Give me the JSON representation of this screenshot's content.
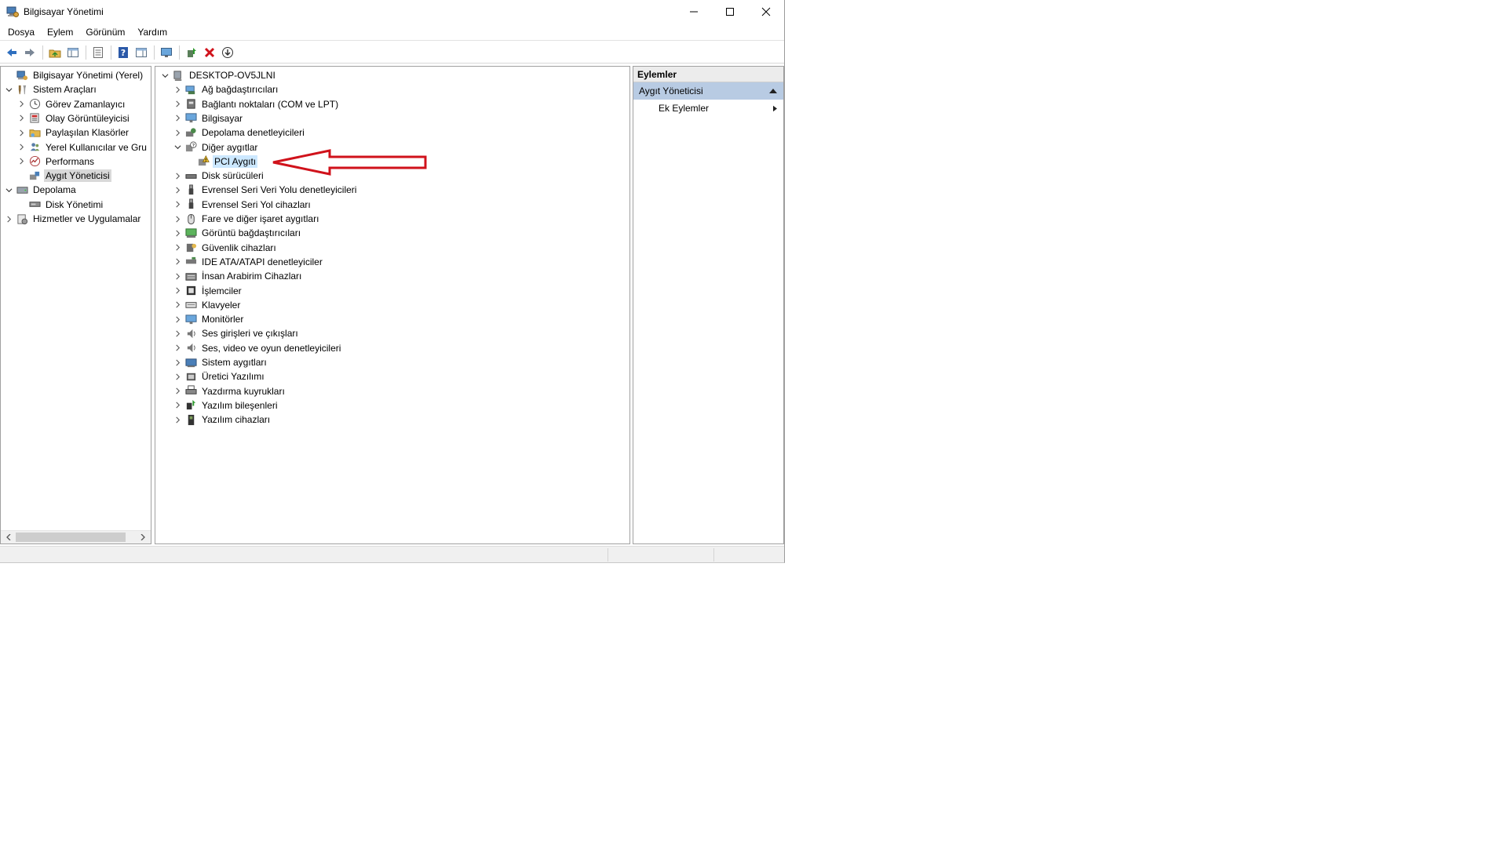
{
  "window": {
    "title": "Bilgisayar Yönetimi",
    "icon": "computer-management-icon"
  },
  "menu": [
    "Dosya",
    "Eylem",
    "Görünüm",
    "Yardım"
  ],
  "toolbar": {
    "icons": [
      "back-arrow-icon",
      "forward-arrow-icon",
      "up-folder-icon",
      "show-hide-tree-icon",
      "properties-icon",
      "help-icon",
      "show-hide-action-pane-icon",
      "monitor-icon",
      "update-driver-icon",
      "uninstall-x-icon",
      "scan-hardware-icon"
    ]
  },
  "left_tree": [
    {
      "label": "Bilgisayar Yönetimi (Yerel)",
      "level": 0,
      "expander": "none",
      "icon": "computer-management-icon"
    },
    {
      "label": "Sistem Araçları",
      "level": 0,
      "expander": "open",
      "icon": "tools-icon"
    },
    {
      "label": "Görev Zamanlayıcı",
      "level": 1,
      "expander": "closed",
      "icon": "clock-icon"
    },
    {
      "label": "Olay Görüntüleyicisi",
      "level": 1,
      "expander": "closed",
      "icon": "event-log-icon"
    },
    {
      "label": "Paylaşılan Klasörler",
      "level": 1,
      "expander": "closed",
      "icon": "shared-folder-icon"
    },
    {
      "label": "Yerel Kullanıcılar ve Gru",
      "level": 1,
      "expander": "closed",
      "icon": "users-icon"
    },
    {
      "label": "Performans",
      "level": 1,
      "expander": "closed",
      "icon": "performance-icon"
    },
    {
      "label": "Aygıt Yöneticisi",
      "level": 1,
      "expander": "none",
      "icon": "device-manager-icon",
      "selected": true
    },
    {
      "label": "Depolama",
      "level": 0,
      "expander": "open",
      "icon": "storage-icon"
    },
    {
      "label": "Disk Yönetimi",
      "level": 1,
      "expander": "none",
      "icon": "disk-management-icon"
    },
    {
      "label": "Hizmetler ve Uygulamalar",
      "level": 0,
      "expander": "closed",
      "icon": "services-icon"
    }
  ],
  "device_tree": {
    "root": {
      "label": "DESKTOP-OV5JLNI",
      "icon": "computer-icon"
    },
    "categories": [
      {
        "label": "Ağ bağdaştırıcıları",
        "icon": "network-adapter-icon",
        "expander": "closed"
      },
      {
        "label": "Bağlantı noktaları (COM ve LPT)",
        "icon": "port-icon",
        "expander": "closed"
      },
      {
        "label": "Bilgisayar",
        "icon": "monitor-icon",
        "expander": "closed"
      },
      {
        "label": "Depolama denetleyicileri",
        "icon": "storage-controller-icon",
        "expander": "closed"
      },
      {
        "label": "Diğer aygıtlar",
        "icon": "unknown-device-icon",
        "expander": "open"
      },
      {
        "label": "PCI Aygıtı",
        "icon": "warning-device-icon",
        "expander": "none",
        "child": true,
        "selected": true
      },
      {
        "label": "Disk sürücüleri",
        "icon": "disk-drive-icon",
        "expander": "closed"
      },
      {
        "label": "Evrensel Seri Veri Yolu denetleyicileri",
        "icon": "usb-icon",
        "expander": "closed"
      },
      {
        "label": "Evrensel Seri Yol cihazları",
        "icon": "usb-icon",
        "expander": "closed"
      },
      {
        "label": "Fare ve diğer işaret aygıtları",
        "icon": "mouse-icon",
        "expander": "closed"
      },
      {
        "label": "Görüntü bağdaştırıcıları",
        "icon": "display-adapter-icon",
        "expander": "closed"
      },
      {
        "label": "Güvenlik cihazları",
        "icon": "security-device-icon",
        "expander": "closed"
      },
      {
        "label": "IDE ATA/ATAPI denetleyiciler",
        "icon": "ide-icon",
        "expander": "closed"
      },
      {
        "label": "İnsan Arabirim Cihazları",
        "icon": "hid-icon",
        "expander": "closed"
      },
      {
        "label": "İşlemciler",
        "icon": "processor-icon",
        "expander": "closed"
      },
      {
        "label": "Klavyeler",
        "icon": "keyboard-icon",
        "expander": "closed"
      },
      {
        "label": "Monitörler",
        "icon": "monitor-icon",
        "expander": "closed"
      },
      {
        "label": "Ses girişleri ve çıkışları",
        "icon": "speaker-icon",
        "expander": "closed"
      },
      {
        "label": "Ses, video ve oyun denetleyicileri",
        "icon": "speaker-icon",
        "expander": "closed"
      },
      {
        "label": "Sistem aygıtları",
        "icon": "system-device-icon",
        "expander": "closed"
      },
      {
        "label": "Üretici Yazılımı",
        "icon": "firmware-icon",
        "expander": "closed"
      },
      {
        "label": "Yazdırma kuyrukları",
        "icon": "printer-icon",
        "expander": "closed"
      },
      {
        "label": "Yazılım bileşenleri",
        "icon": "software-component-icon",
        "expander": "closed"
      },
      {
        "label": "Yazılım cihazları",
        "icon": "software-device-icon",
        "expander": "closed"
      }
    ]
  },
  "actions": {
    "header": "Eylemler",
    "section": "Aygıt Yöneticisi",
    "items": [
      "Ek Eylemler"
    ]
  },
  "colors": {
    "selection_gray": "#d9d9d9",
    "selection_blue": "#cce8ff",
    "actions_section": "#b8cbe3",
    "annotation_red": "#d0121b"
  }
}
